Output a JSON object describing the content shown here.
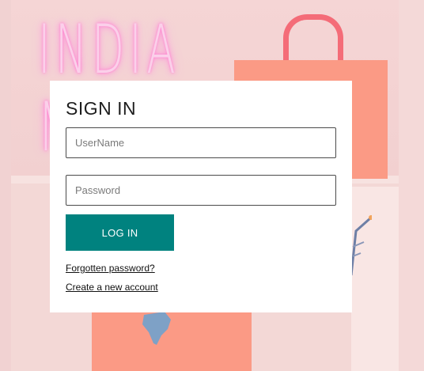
{
  "background": {
    "neon_line_1": "INDIA",
    "neon_line_2": "M",
    "neon_color": "#fbd0ea",
    "bag_color": "#fb9a85"
  },
  "signin": {
    "title": "SIGN IN",
    "username_placeholder": "UserName",
    "password_placeholder": "Password",
    "login_label": "LOG IN",
    "forgot_label": "Forgotten password?",
    "create_label": "Create a new account",
    "accent_color": "#00827f"
  }
}
